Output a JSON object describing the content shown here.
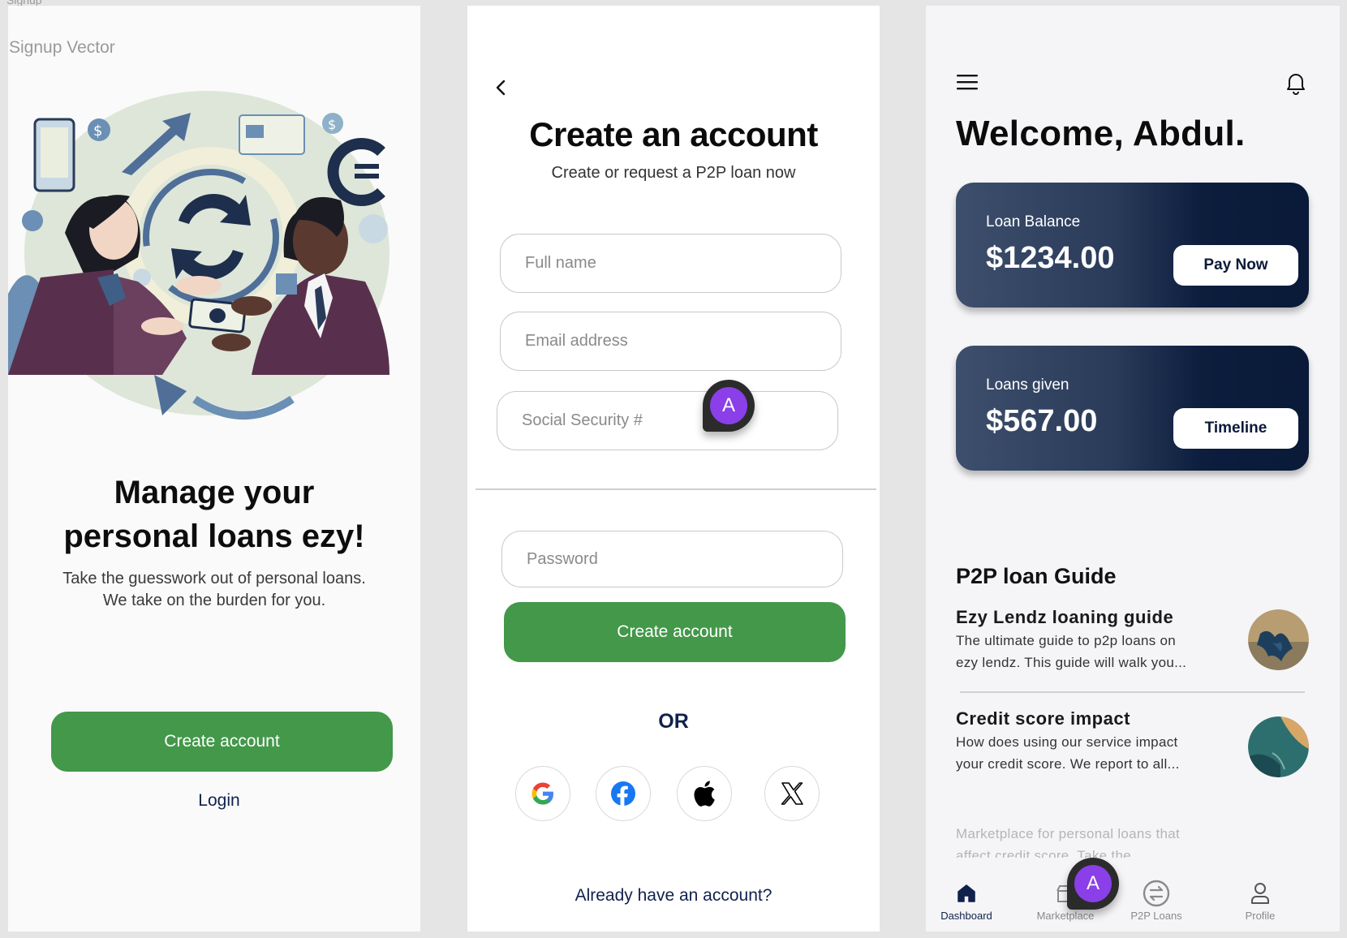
{
  "frame_tag": "Signup",
  "screen1": {
    "vector_label": "Signup Vector",
    "title_line1": "Manage your",
    "title_line2": "personal loans ezy!",
    "subtitle_line1": "Take the guesswork out of personal loans.",
    "subtitle_line2": "We take on the burden for you.",
    "create_account": "Create account",
    "login": "Login"
  },
  "screen2": {
    "title": "Create an account",
    "subtitle": "Create or request a P2P loan now",
    "fields": {
      "full_name": "Full name",
      "email": "Email address",
      "ssn": "Social Security #",
      "password": "Password"
    },
    "create_account": "Create account",
    "or": "OR",
    "social": [
      "google-icon",
      "facebook-icon",
      "apple-icon",
      "x-icon"
    ],
    "already": "Already have an account?"
  },
  "avatar_letter": "A",
  "screen3": {
    "welcome": "Welcome, Abdul.",
    "cards": [
      {
        "label": "Loan Balance",
        "amount": "$1234.00",
        "button": "Pay Now"
      },
      {
        "label": "Loans given",
        "amount": "$567.00",
        "button": "Timeline"
      }
    ],
    "guide_title": "P2P loan Guide",
    "guides": [
      {
        "title": "Ezy Lendz loaning guide",
        "desc_line1": "The ultimate guide to p2p loans on",
        "desc_line2": "ezy lendz. This guide will walk you..."
      },
      {
        "title": "Credit score impact",
        "desc_line1": "How does using our service impact",
        "desc_line2": "your credit score. We report to all..."
      }
    ],
    "fade_line1": "Marketplace for personal loans that",
    "fade_line2": "affect credit score. Take the",
    "tabs": [
      {
        "label": "Dashboard",
        "icon": "home-icon"
      },
      {
        "label": "Marketplace",
        "icon": "store-icon"
      },
      {
        "label": "P2P Loans",
        "icon": "exchange-icon"
      },
      {
        "label": "Profile",
        "icon": "user-icon"
      }
    ]
  },
  "colors": {
    "green": "#43984a",
    "navy": "#11214d",
    "card_dark": "#0a1a38",
    "avatar_purple": "#8a3fe8"
  }
}
